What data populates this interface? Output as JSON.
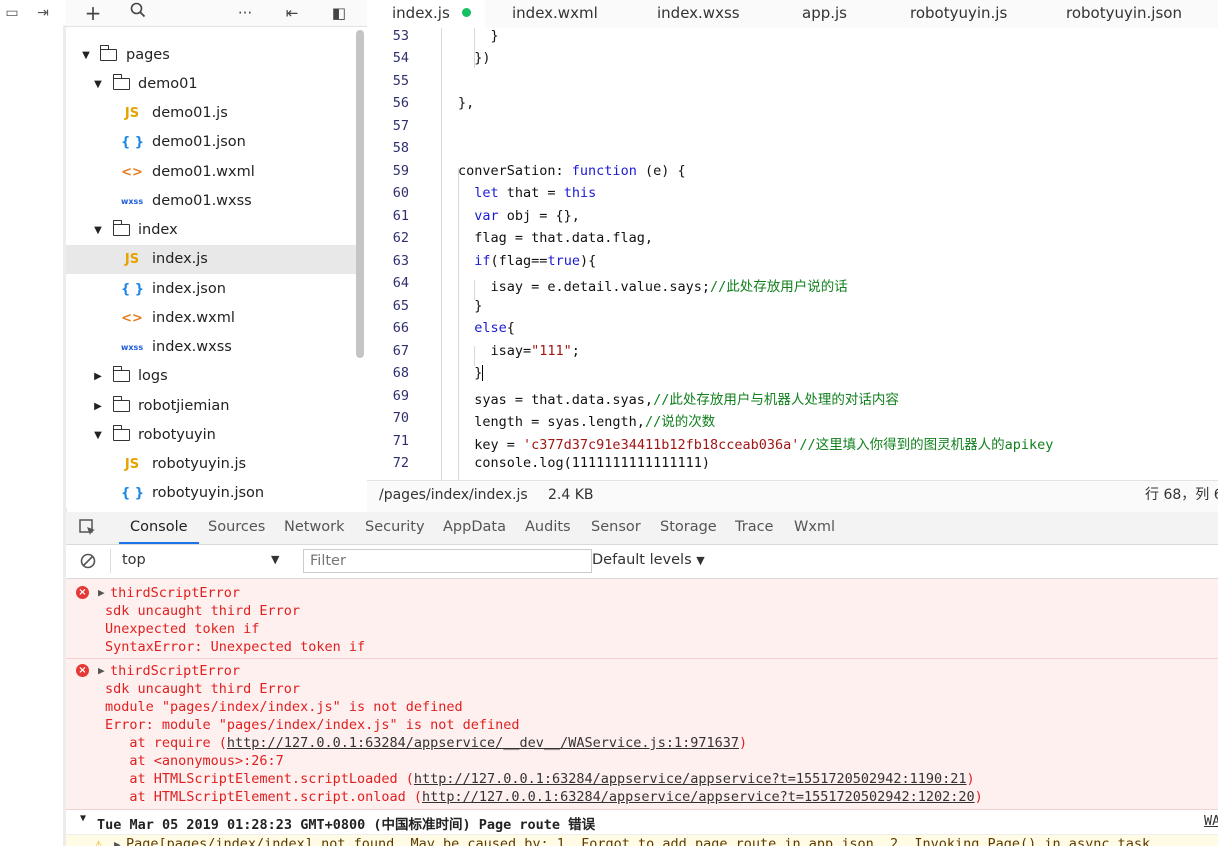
{
  "tabs": [
    {
      "label": "index.js",
      "modified": true
    },
    {
      "label": "index.wxml"
    },
    {
      "label": "index.wxss"
    },
    {
      "label": "app.js"
    },
    {
      "label": "robotyuyin.js"
    },
    {
      "label": "robotyuyin.json"
    }
  ],
  "tree": [
    {
      "label": "pages",
      "kind": "folder",
      "open": true
    },
    {
      "label": "demo01",
      "kind": "folder",
      "open": true
    },
    {
      "label": "demo01.js",
      "kind": "js",
      "icon": "JS"
    },
    {
      "label": "demo01.json",
      "kind": "json",
      "icon": "{ }"
    },
    {
      "label": "demo01.wxml",
      "kind": "wxml",
      "icon": "<>"
    },
    {
      "label": "demo01.wxss",
      "kind": "wxss",
      "icon": "wxss"
    },
    {
      "label": "index",
      "kind": "folder",
      "open": true
    },
    {
      "label": "index.js",
      "kind": "js",
      "icon": "JS",
      "selected": true
    },
    {
      "label": "index.json",
      "kind": "json",
      "icon": "{ }"
    },
    {
      "label": "index.wxml",
      "kind": "wxml",
      "icon": "<>"
    },
    {
      "label": "index.wxss",
      "kind": "wxss",
      "icon": "wxss"
    },
    {
      "label": "logs",
      "kind": "folder",
      "open": false
    },
    {
      "label": "robotjiemian",
      "kind": "folder",
      "open": false
    },
    {
      "label": "robotyuyin",
      "kind": "folder",
      "open": true
    },
    {
      "label": "robotyuyin.js",
      "kind": "js",
      "icon": "JS"
    },
    {
      "label": "robotyuyin.json",
      "kind": "json",
      "icon": "{ }"
    }
  ],
  "code": [
    {
      "n": "53",
      "t": "    }"
    },
    {
      "n": "54",
      "t": "  })"
    },
    {
      "n": "55",
      "t": ""
    },
    {
      "n": "56",
      "t": "},"
    },
    {
      "n": "57",
      "t": ""
    },
    {
      "n": "58",
      "t": ""
    },
    {
      "n": "59",
      "t": "converSation: function (e) {"
    },
    {
      "n": "60",
      "t": "  let that = this"
    },
    {
      "n": "61",
      "t": "  var obj = {},"
    },
    {
      "n": "62",
      "t": "  flag = that.data.flag,"
    },
    {
      "n": "63",
      "t": "  if(flag==true){"
    },
    {
      "n": "64",
      "t": "    isay = e.detail.value.says;//此处存放用户说的话"
    },
    {
      "n": "65",
      "t": "  }"
    },
    {
      "n": "66",
      "t": "  else{"
    },
    {
      "n": "67",
      "t": "    isay=\"111\";"
    },
    {
      "n": "68",
      "t": "  }"
    },
    {
      "n": "69",
      "t": "  syas = that.data.syas,//此处存放用户与机器人处理的对话内容"
    },
    {
      "n": "70",
      "t": "  length = syas.length,//说的次数"
    },
    {
      "n": "71",
      "t": "  key = 'c377d37c91e34411b12fb18cceab036a'//这里填入你得到的图灵机器人的apikey"
    },
    {
      "n": "72",
      "t": "  console.log(1111111111111111)"
    }
  ],
  "status": {
    "path": "/pages/index/index.js",
    "size": "2.4 KB",
    "cursor": "行 68，列 6"
  },
  "devtools": {
    "tabs": [
      "Console",
      "Sources",
      "Network",
      "Security",
      "AppData",
      "Audits",
      "Sensor",
      "Storage",
      "Trace",
      "Wxml"
    ],
    "context": "top",
    "filter_placeholder": "Filter",
    "levels": "Default levels"
  },
  "console": {
    "error1": [
      "thirdScriptError",
      "sdk uncaught third Error",
      "Unexpected token if",
      "SyntaxError: Unexpected token if"
    ],
    "error2": [
      "thirdScriptError",
      "sdk uncaught third Error",
      "module \"pages/index/index.js\" is not defined",
      "Error: module \"pages/index/index.js\" is not defined"
    ],
    "stack": [
      {
        "pre": "   at require (",
        "link": "http://127.0.0.1:63284/appservice/__dev__/WAService.js:1:971637",
        "post": ")"
      },
      {
        "pre": "   at <anonymous>:26:7",
        "link": "",
        "post": ""
      },
      {
        "pre": "   at HTMLScriptElement.scriptLoaded (",
        "link": "http://127.0.0.1:63284/appservice/appservice?t=1551720502942:1190:21",
        "post": ")"
      },
      {
        "pre": "   at HTMLScriptElement.script.onload (",
        "link": "http://127.0.0.1:63284/appservice/appservice?t=1551720502942:1202:20",
        "post": ")"
      }
    ],
    "group_line": "Tue Mar 05 2019 01:28:23 GMT+0800 (中国标准时间) Page route 错误",
    "group_side": "WA",
    "warn_line": "Page[pages/index/index] not found. May be caused by: 1. Forgot to add page route in app.json. 2. Invoking Page() in async task."
  }
}
